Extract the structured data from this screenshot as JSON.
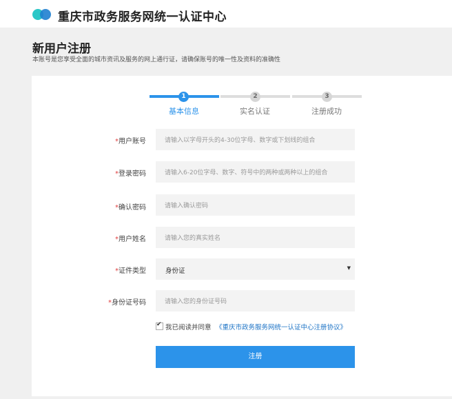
{
  "header": {
    "site_title": "重庆市政务服务网统一认证中心"
  },
  "page": {
    "title": "新用户注册",
    "description": "本账号是您享受全面的城市资讯及服务的网上通行证，请确保账号的唯一性及资料的准确性"
  },
  "steps": [
    {
      "number": "1",
      "label": "基本信息",
      "active": true
    },
    {
      "number": "2",
      "label": "实名认证",
      "active": false
    },
    {
      "number": "3",
      "label": "注册成功",
      "active": false
    }
  ],
  "form": {
    "required_mark": "*",
    "username": {
      "label": "用户账号",
      "placeholder": "请输入以字母开头的4-30位字母、数字或下划线的组合"
    },
    "password": {
      "label": "登录密码",
      "placeholder": "请输入6-20位字母、数字、符号中的两种或两种以上的组合"
    },
    "confirm_password": {
      "label": "确认密码",
      "placeholder": "请输入确认密码"
    },
    "real_name": {
      "label": "用户姓名",
      "placeholder": "请输入您的真实姓名"
    },
    "id_type": {
      "label": "证件类型",
      "value": "身份证",
      "arrow": "▼"
    },
    "id_number": {
      "label": "身份证号码",
      "placeholder": "请输入您的身份证号码"
    }
  },
  "agreement": {
    "checked": true,
    "text": "我已阅读并同意",
    "link": "《重庆市政务服务网统一认证中心注册协议》"
  },
  "submit_label": "注册",
  "colors": {
    "accent": "#2c93ea",
    "link": "#1e74c6",
    "required": "#e04040",
    "step_inactive": "#dddddd"
  }
}
